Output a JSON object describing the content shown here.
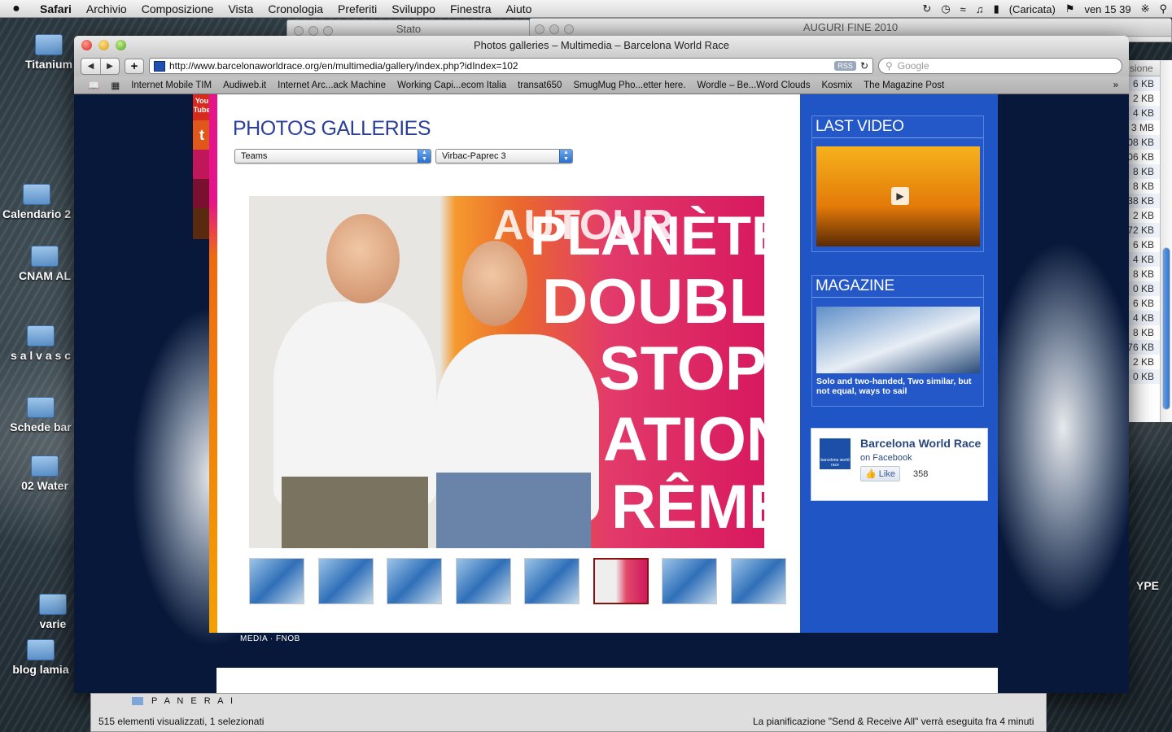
{
  "menubar": {
    "apple": "",
    "app": "Safari",
    "items": [
      "Archivio",
      "Composizione",
      "Vista",
      "Cronologia",
      "Preferiti",
      "Sviluppo",
      "Finestra",
      "Aiuto"
    ],
    "battery": "(Caricata)",
    "clock": "ven 15 39"
  },
  "desktop": {
    "icons": [
      "Titanium",
      "Calendario 2",
      "CNAM AL",
      "s a l v a s c",
      "Schede bar",
      "02 Water",
      "varie",
      "blog lamia"
    ],
    "right_label": "YPE"
  },
  "bg_windows": {
    "stato": "Stato",
    "auguri": "AUGURI FINE 2010"
  },
  "filelist": {
    "header": "sione",
    "sizes": [
      "6 KB",
      "2 KB",
      "4 KB",
      "3 MB",
      "08 KB",
      "06 KB",
      "8 KB",
      "8 KB",
      "38 KB",
      "2 KB",
      "72 KB",
      "6 KB",
      "4 KB",
      "8 KB",
      "0 KB",
      "6 KB",
      "4 KB",
      "8 KB",
      "76 KB",
      "2 KB",
      "0 KB"
    ]
  },
  "window": {
    "title": "Photos galleries – Multimedia – Barcelona World Race",
    "url": "http://www.barcelonaworldrace.org/en/multimedia/gallery/index.php?idIndex=102",
    "rss": "RSS",
    "search_placeholder": "Google",
    "bookmarks": [
      "Internet Mobile TIM",
      "Audiweb.it",
      "Internet Arc...ack Machine",
      "Working Capi...ecom Italia",
      "transat650",
      "SmugMug Pho...etter here.",
      "Wordle – Be...Word Clouds",
      "Kosmix",
      "The Magazine Post"
    ]
  },
  "page": {
    "social": {
      "youtube_top": "You",
      "youtube_bottom": "Tube",
      "twitter": "t"
    },
    "title": "PHOTOS GALLERIES",
    "select1": "Teams",
    "select2": "Virbac-Paprec 3",
    "photo_text": [
      "AUTOUR",
      "PLANÈTE",
      "DOUBLE",
      "STOP",
      "ATION",
      "RÊME"
    ],
    "thumb_count": 8,
    "selected_thumb": 6,
    "sidebar": {
      "last_video": "LAST VIDEO",
      "magazine": "MAGAZINE",
      "magazine_caption": "Solo and two-handed, Two similar, but not equal, ways to sail",
      "fb_name": "Barcelona World Race",
      "fb_on": "on Facebook",
      "fb_like": "Like",
      "fb_count": "358",
      "fb_logo": "barcelona world race"
    },
    "footer": "MEDIA  ·  FNOB"
  },
  "finder": {
    "folder": "P A N E R A I",
    "status_left": "515 elementi visualizzati, 1 selezionati",
    "status_right": "La pianificazione \"Send & Receive All\" verrà eseguita fra 4 minuti"
  }
}
